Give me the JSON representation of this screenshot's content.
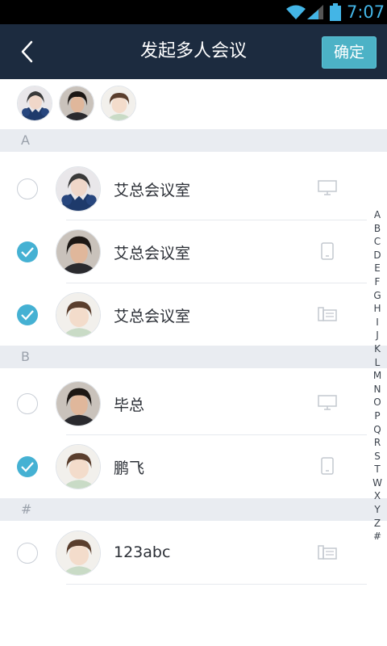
{
  "status_bar": {
    "time": "7:07",
    "icons": [
      "wifi-icon",
      "signal-icon",
      "battery-icon"
    ]
  },
  "nav": {
    "back_icon": "chevron-left-icon",
    "title": "发起多人会议",
    "confirm_label": "确定"
  },
  "selected_avatars": [
    "avatar-woman-fur",
    "avatar-man-dark-hair",
    "avatar-child"
  ],
  "sections": [
    {
      "letter": "A",
      "contacts": [
        {
          "name": "艾总会议室",
          "checked": false,
          "avatar": "avatar-woman-fur",
          "device": "monitor-icon"
        },
        {
          "name": "艾总会议室",
          "checked": true,
          "avatar": "avatar-man-dark-hair",
          "device": "phone-icon"
        },
        {
          "name": "艾总会议室",
          "checked": true,
          "avatar": "avatar-child",
          "device": "desk-phone-icon"
        }
      ]
    },
    {
      "letter": "B",
      "contacts": [
        {
          "name": "毕总",
          "checked": false,
          "avatar": "avatar-man-dark-hair",
          "device": "monitor-icon"
        },
        {
          "name": "鹏飞",
          "checked": true,
          "avatar": "avatar-child",
          "device": "phone-icon"
        }
      ]
    },
    {
      "letter": "#",
      "contacts": [
        {
          "name": "123abc",
          "checked": false,
          "avatar": "avatar-child",
          "device": "desk-phone-icon"
        }
      ]
    }
  ],
  "index_letters": [
    "A",
    "B",
    "C",
    "D",
    "E",
    "F",
    "G",
    "H",
    "I",
    "J",
    "K",
    "L",
    "M",
    "N",
    "O",
    "P",
    "Q",
    "R",
    "S",
    "T",
    "W",
    "X",
    "Y",
    "Z",
    "#"
  ],
  "colors": {
    "nav_bg": "#1c2b3f",
    "accent": "#45b1d3",
    "confirm_bg": "#4cb2c6",
    "section_bg": "#e9ecf1",
    "time": "#43b5e6"
  }
}
